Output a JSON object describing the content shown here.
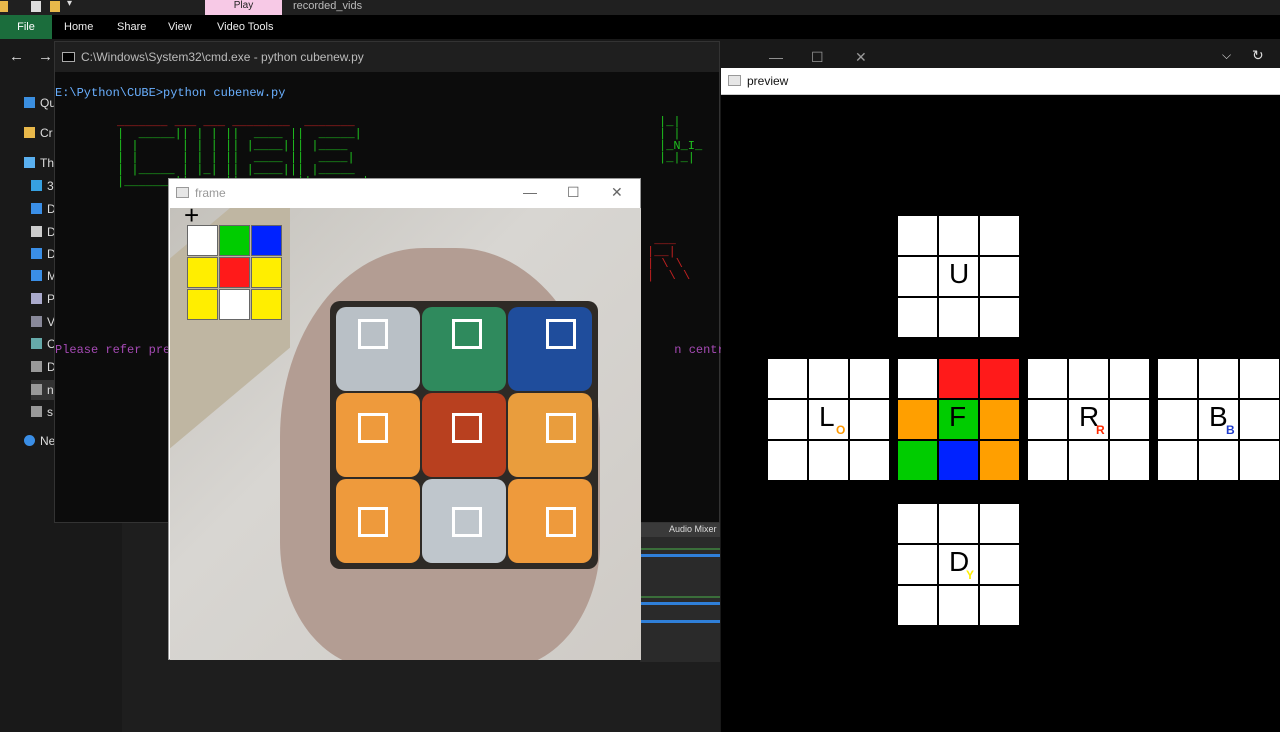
{
  "explorer": {
    "play_tab": "Play",
    "folder_title": "recorded_vids",
    "ribbon": [
      "File",
      "Home",
      "Share",
      "View",
      "Video Tools"
    ],
    "sidebar": [
      "Qu",
      "Cr",
      "Th",
      "3",
      "D",
      "D",
      "D",
      "M",
      "P",
      "V",
      "C",
      "D",
      "n",
      "s",
      "Ne"
    ]
  },
  "cmd": {
    "title": "C:\\Windows\\System32\\cmd.exe - python  cubenew.py",
    "prompt": "E:\\Python\\CUBE>python cubenew.py",
    "refer_line": "Please refer prev                                                                     n centre on"
  },
  "mixer": {
    "label": "Audio Mixer"
  },
  "frame": {
    "title": "frame",
    "detected_grid": [
      "#ffffff",
      "#00cc00",
      "#0022ff",
      "#ffee00",
      "#ff1a1a",
      "#ffee00",
      "#ffee00",
      "#ffffff",
      "#ffee00"
    ],
    "stickers": [
      "#b9c0c6",
      "#2f8a5d",
      "#1f4d9c",
      "#ee9a3c",
      "#b8401f",
      "#e99d3d",
      "#ee9a3c",
      "#bfc6cc",
      "#ee9a3c"
    ]
  },
  "preview": {
    "title": "preview",
    "faces": {
      "U": {
        "letter": "U",
        "sub": ""
      },
      "L": {
        "letter": "L",
        "sub": "O",
        "sub_color": "#ff9900"
      },
      "F": {
        "letter": "F",
        "sub": ""
      },
      "R": {
        "letter": "R",
        "sub": "R",
        "sub_color": "#ff2a00"
      },
      "B": {
        "letter": "B",
        "sub": "B",
        "sub_color": "#1f3ccc"
      },
      "D": {
        "letter": "D",
        "sub": "Y",
        "sub_color": "#ffee00"
      }
    },
    "front_colors": [
      "#ffffff",
      "#ff1a1a",
      "#ff1a1a",
      "#ff9f00",
      "#00cc00",
      "#ff9f00",
      "#00cc00",
      "#0022ff",
      "#ff9f00"
    ]
  }
}
